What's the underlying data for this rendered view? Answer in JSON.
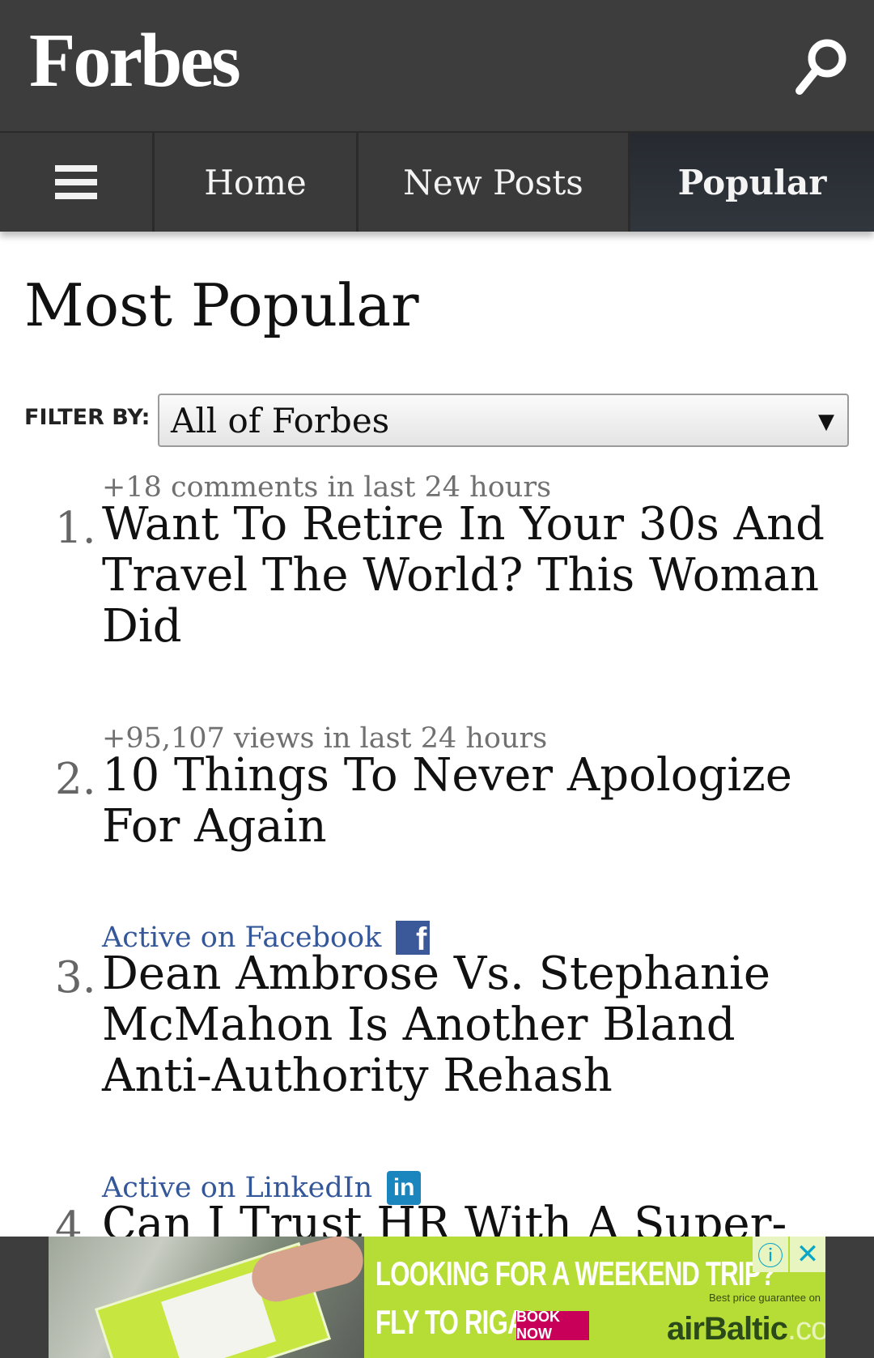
{
  "header": {
    "logo": "Forbes",
    "search_icon": "search-icon"
  },
  "nav": {
    "menu_icon": "hamburger-menu-icon",
    "home": "Home",
    "new_posts": "New Posts",
    "popular": "Popular",
    "active_tab": "Popular"
  },
  "main": {
    "title": "Most Popular",
    "filter_label": "FILTER BY:",
    "filter_value": "All of Forbes",
    "filter_arrow": "▼"
  },
  "articles": [
    {
      "rank": "1.",
      "meta": "+18 comments in last 24 hours",
      "title": "Want To Retire In Your 30s And Travel The World? This Woman Did"
    },
    {
      "rank": "2.",
      "meta": "+95,107 views in last 24 hours",
      "title": "10 Things To Never Apologize For Again"
    },
    {
      "rank": "3.",
      "meta": "Active on Facebook",
      "icon": "facebook-icon",
      "title": "Dean Ambrose Vs. Stephanie McMahon Is Another Bland Anti-Authority Rehash"
    },
    {
      "rank": "4.",
      "meta": "Active on LinkedIn",
      "icon": "linkedin-icon",
      "title": "Can I Trust HR With A Super-"
    }
  ],
  "ad": {
    "headline": "LOOKING FOR A WEEKEND TRIP?",
    "subline": "FLY TO RIGA!",
    "cta": "BOOK NOW",
    "fine_print": "Best price guarantee on",
    "brand": "airBaltic",
    "brand_suffix": ".com",
    "info_icon": "ⓘ",
    "close_icon": "✕",
    "colors": {
      "background": "#b6dd36",
      "cta": "#c8005a"
    }
  },
  "colors": {
    "header_bg": "#3d3d3d",
    "active_tab_bg": "#262a30",
    "social_link": "#34579a"
  }
}
